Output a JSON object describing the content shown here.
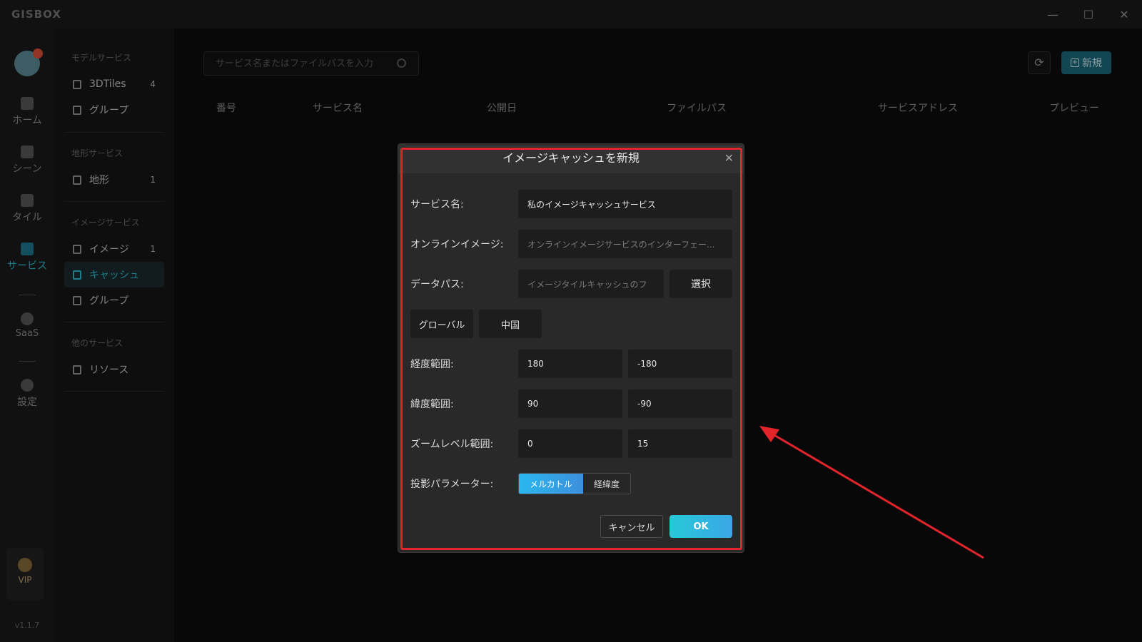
{
  "app": {
    "logo": "GISBOX"
  },
  "window_controls": {
    "minimize": "—",
    "maximize": "☐",
    "close": "✕"
  },
  "rail": {
    "items": [
      {
        "label": "ホーム",
        "icon": "home-icon"
      },
      {
        "label": "シーン",
        "icon": "scene-icon"
      },
      {
        "label": "タイル",
        "icon": "tile-icon"
      },
      {
        "label": "サービス",
        "icon": "service-icon"
      },
      {
        "label": "SaaS",
        "icon": "lock-icon"
      },
      {
        "label": "設定",
        "icon": "settings-icon"
      }
    ],
    "vip": "VIP",
    "version": "v1.1.7"
  },
  "sidenav": {
    "groups": [
      {
        "title": "モデルサービス",
        "items": [
          {
            "label": "3DTiles",
            "count": "4"
          },
          {
            "label": "グループ",
            "count": ""
          }
        ]
      },
      {
        "title": "地形サービス",
        "items": [
          {
            "label": "地形",
            "count": "1"
          }
        ]
      },
      {
        "title": "イメージサービス",
        "items": [
          {
            "label": "イメージ",
            "count": "1"
          },
          {
            "label": "キャッシュ",
            "count": ""
          },
          {
            "label": "グループ",
            "count": ""
          }
        ]
      },
      {
        "title": "他のサービス",
        "items": [
          {
            "label": "リソース",
            "count": ""
          }
        ]
      }
    ]
  },
  "main": {
    "search_placeholder": "サービス名またはファイルパスを入力",
    "new_label": "新規",
    "columns": [
      "番号",
      "サービス名",
      "公開日",
      "ファイルパス",
      "サービスアドレス",
      "プレビュー"
    ]
  },
  "dialog": {
    "title": "イメージキャッシュを新規",
    "service_name_label": "サービス名:",
    "service_name_value": "私のイメージキャッシュサービス",
    "online_label": "オンラインイメージ:",
    "online_placeholder": "オンラインイメージサービスのインターフェー...",
    "datapath_label": "データパス:",
    "datapath_placeholder": "イメージタイルキャッシュのフ",
    "select_label": "選択",
    "global_label": "グローバル",
    "china_label": "中国",
    "lon_label": "経度範囲:",
    "lon_min": "180",
    "lon_max": "-180",
    "lat_label": "緯度範囲:",
    "lat_min": "90",
    "lat_max": "-90",
    "zoom_label": "ズームレベル範囲:",
    "zoom_min": "0",
    "zoom_max": "15",
    "proj_label": "投影パラメーター:",
    "proj_mercator": "メルカトル",
    "proj_latlon": "経緯度",
    "cancel_label": "キャンセル",
    "ok_label": "OK"
  },
  "colors": {
    "accent": "#2cc1d8",
    "annotation": "#e3242b"
  }
}
